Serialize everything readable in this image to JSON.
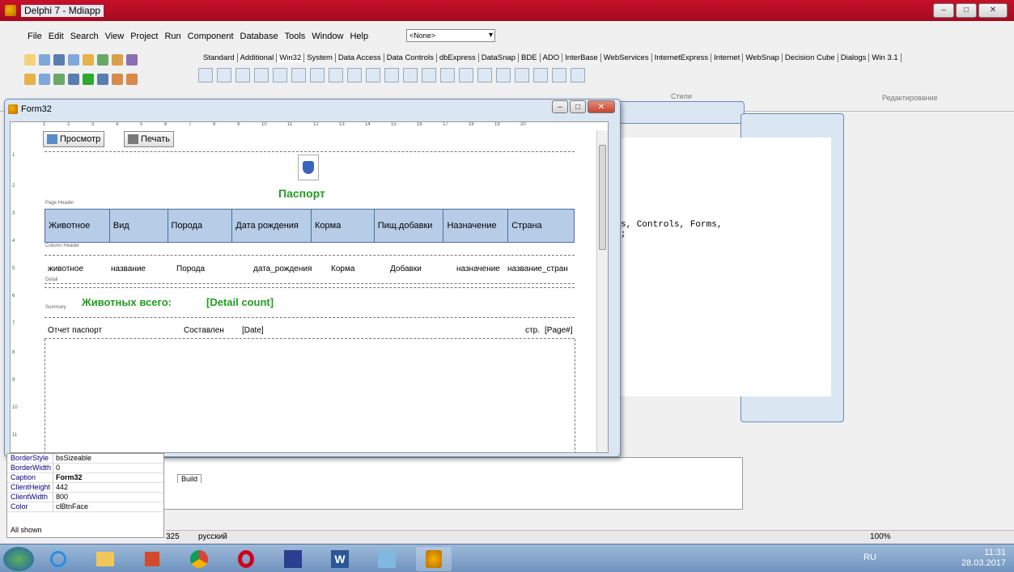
{
  "app": {
    "title": "Delphi 7 - Mdiapp"
  },
  "menu": [
    "File",
    "Edit",
    "Search",
    "View",
    "Project",
    "Run",
    "Component",
    "Database",
    "Tools",
    "Window",
    "Help"
  ],
  "toolbar": {
    "combo_value": "<None>"
  },
  "palette_tabs": [
    "Standard",
    "Additional",
    "Win32",
    "System",
    "Data Access",
    "Data Controls",
    "dbExpress",
    "DataSnap",
    "BDE",
    "ADO",
    "InterBase",
    "WebServices",
    "InternetExpress",
    "Internet",
    "WebSnap",
    "Decision Cube",
    "Dialogs",
    "Win 3.1"
  ],
  "palette_active": "Win32",
  "form": {
    "title": "Form32",
    "preview_button": "Просмотр",
    "print_button": "Печать",
    "page_header_label": "Page Header",
    "column_header_label": "Column Header",
    "detail_label": "Detail",
    "summary_label": "Summary",
    "report_title": "Паспорт",
    "columns": [
      "Животное",
      "Вид",
      "Порода",
      "Дата рождения",
      "Корма",
      "Пищ.добавки",
      "Назначение",
      "Страна"
    ],
    "detail_fields": [
      "животное",
      "название",
      "Порода",
      "дата_рождения",
      "Корма",
      "Добавки",
      "назначение",
      "название_стран"
    ],
    "summary_text": "Животных всего:",
    "summary_count": "[Detail count]",
    "footer_left": "Отчет паспорт",
    "footer_made": "Составлен",
    "footer_date": "[Date]",
    "footer_page_label": "стр.",
    "footer_page": "[Page#]"
  },
  "bg": {
    "styles_label": "Стили",
    "editing_label": "Редактирование",
    "code_line": "s, Controls, Forms,",
    "code_line2": ";",
    "build_tab": "Build"
  },
  "inspector": {
    "rows": [
      {
        "k": "BorderStyle",
        "v": "bsSizeable"
      },
      {
        "k": "BorderWidth",
        "v": "0"
      },
      {
        "k": "Caption",
        "v": "Form32"
      },
      {
        "k": "ClientHeight",
        "v": "442"
      },
      {
        "k": "ClientWidth",
        "v": "800"
      },
      {
        "k": "Color",
        "v": "clBtnFace"
      }
    ],
    "footer": "All shown"
  },
  "status": {
    "left_num": "325",
    "lang": "русский",
    "zoom": "100%"
  },
  "tray": {
    "lang": "RU",
    "time": "11:31",
    "date": "28.03.2017"
  },
  "colors": {
    "title_red": "#c7102a",
    "green_text": "#1f9e1f",
    "header_fill": "#b7cde7"
  }
}
